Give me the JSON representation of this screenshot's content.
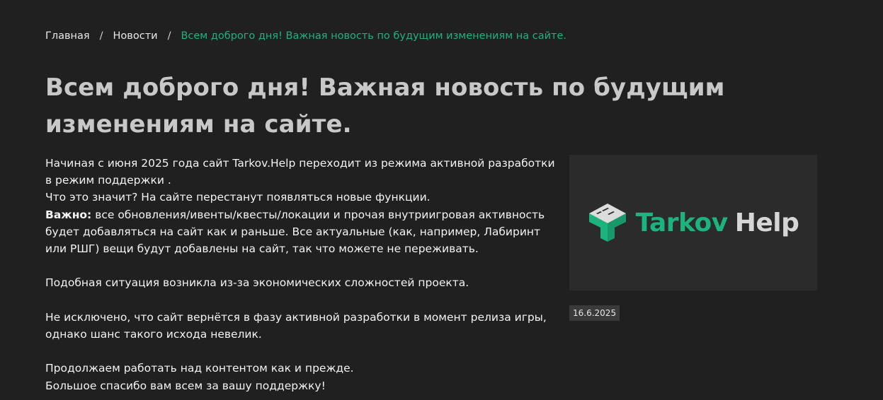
{
  "breadcrumb": {
    "home": "Главная",
    "news": "Новости",
    "current": "Всем доброго дня! Важная новость по будущим изменениям на сайте.",
    "separator": "/"
  },
  "article": {
    "title": "Всем доброго дня! Важная новость по будущим изменениям на сайте.",
    "p1": "Начиная с июня 2025 года сайт Tarkov.Help переходит из режима активной разработки в режим поддержки .",
    "p2": "Что это значит? На сайте перестанут появляться новые функции.",
    "p3_label": "Важно:",
    "p3_text": " все обновления/ивенты/квесты/локации и прочая внутриигровая активность будет добавляться на сайт как и раньше. Все актуальные (как, например, Лабиринт или РШГ) вещи будут добавлены на сайт, так что можете не переживать.",
    "p4": "Подобная ситуация возникла из-за экономических сложностей проекта.",
    "p5": "Не исключено, что сайт вернётся в фазу активной разработки в момент релиза игры, однако шанс такого исхода невелик.",
    "p6": "Продолжаем работать над контентом как и прежде.",
    "p7": "Большое спасибо вам всем за вашу поддержку!",
    "date": "16.6.2025"
  },
  "logo": {
    "word1": "Tarkov",
    "word2": "Help",
    "icon": "tarkov-help-logo-icon"
  },
  "colors": {
    "background": "#202020",
    "accent": "#1db37e",
    "title": "#c8c8c8",
    "text": "#f3f3f3",
    "card": "#2b2b2b",
    "date_badge": "#3a3a3a"
  }
}
